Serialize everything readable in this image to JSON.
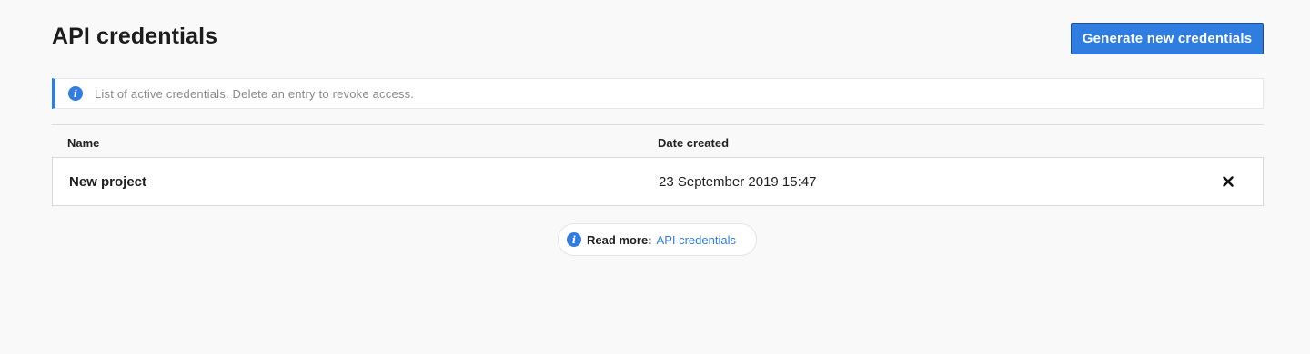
{
  "header": {
    "title": "API credentials",
    "generate_button_label": "Generate new credentials"
  },
  "info_banner": {
    "icon": "info-icon",
    "text": "List of active credentials. Delete an entry to revoke access."
  },
  "table": {
    "columns": [
      "Name",
      "Date created"
    ],
    "rows": [
      {
        "name": "New project",
        "date_created": "23 September 2019 15:47",
        "action_icon": "close-icon"
      }
    ]
  },
  "read_more": {
    "icon": "info-icon",
    "label": "Read more:",
    "link_text": "API credentials"
  },
  "colors": {
    "accent": "#2f7de1",
    "background": "#f9f9f9"
  }
}
